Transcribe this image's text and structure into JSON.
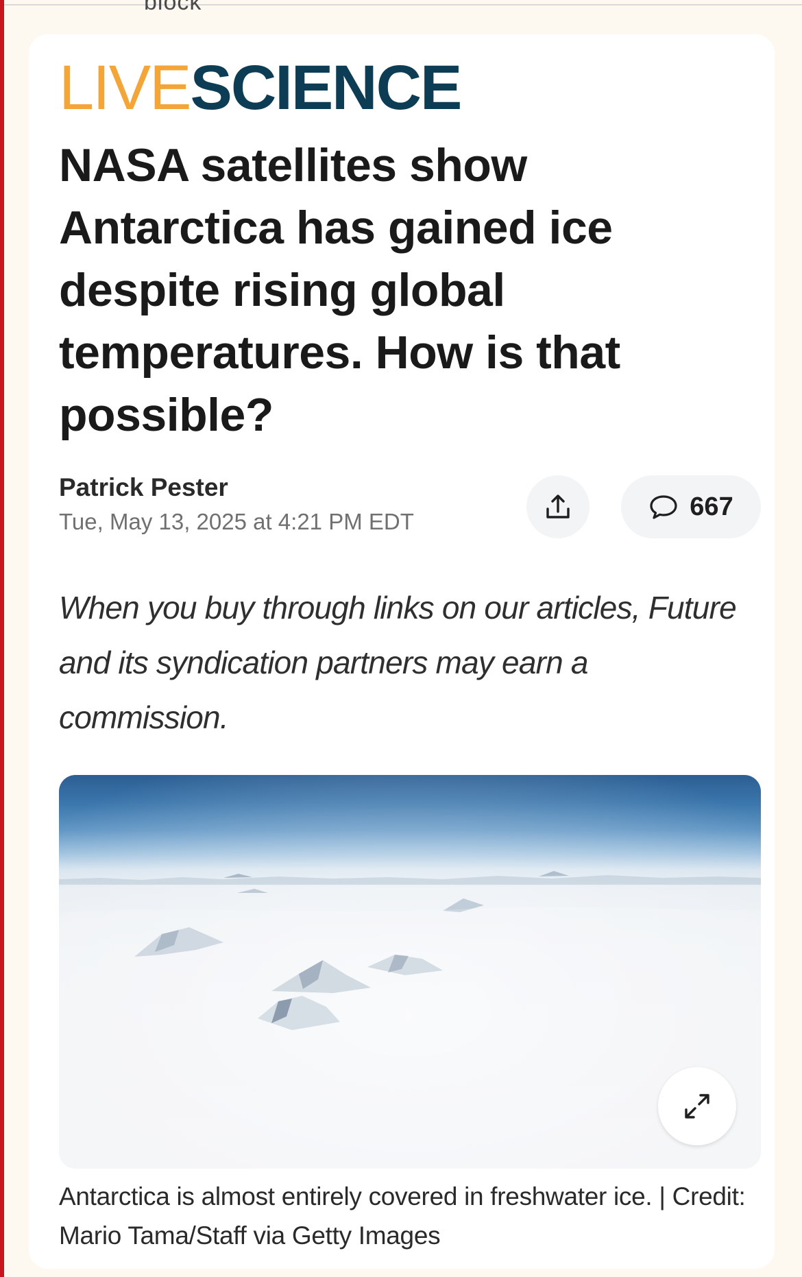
{
  "top_clipped_word": "block",
  "brand": {
    "logo_part1": "LIVE",
    "logo_part2": "SCIENCE",
    "colors": {
      "live": "#f3a537",
      "science": "#0d3c55"
    }
  },
  "article": {
    "headline": "NASA satellites show Antarctica has gained ice despite rising global temperatures. How is that possible?",
    "author": "Patrick Pester",
    "date": "Tue, May 13, 2025 at 4:21 PM EDT",
    "disclaimer": "When you buy through links on our articles, Future and its syndication partners may earn a commission.",
    "caption": "Antarctica is almost entirely covered in freshwater ice. | Credit: Mario Tama/Staff via Getty Images"
  },
  "actions": {
    "share_icon": "share-upload-icon",
    "comment_icon": "comment-bubble-icon",
    "comment_count": "667",
    "expand_icon": "expand-arrows-icon"
  },
  "accent_color": "#c7161d"
}
